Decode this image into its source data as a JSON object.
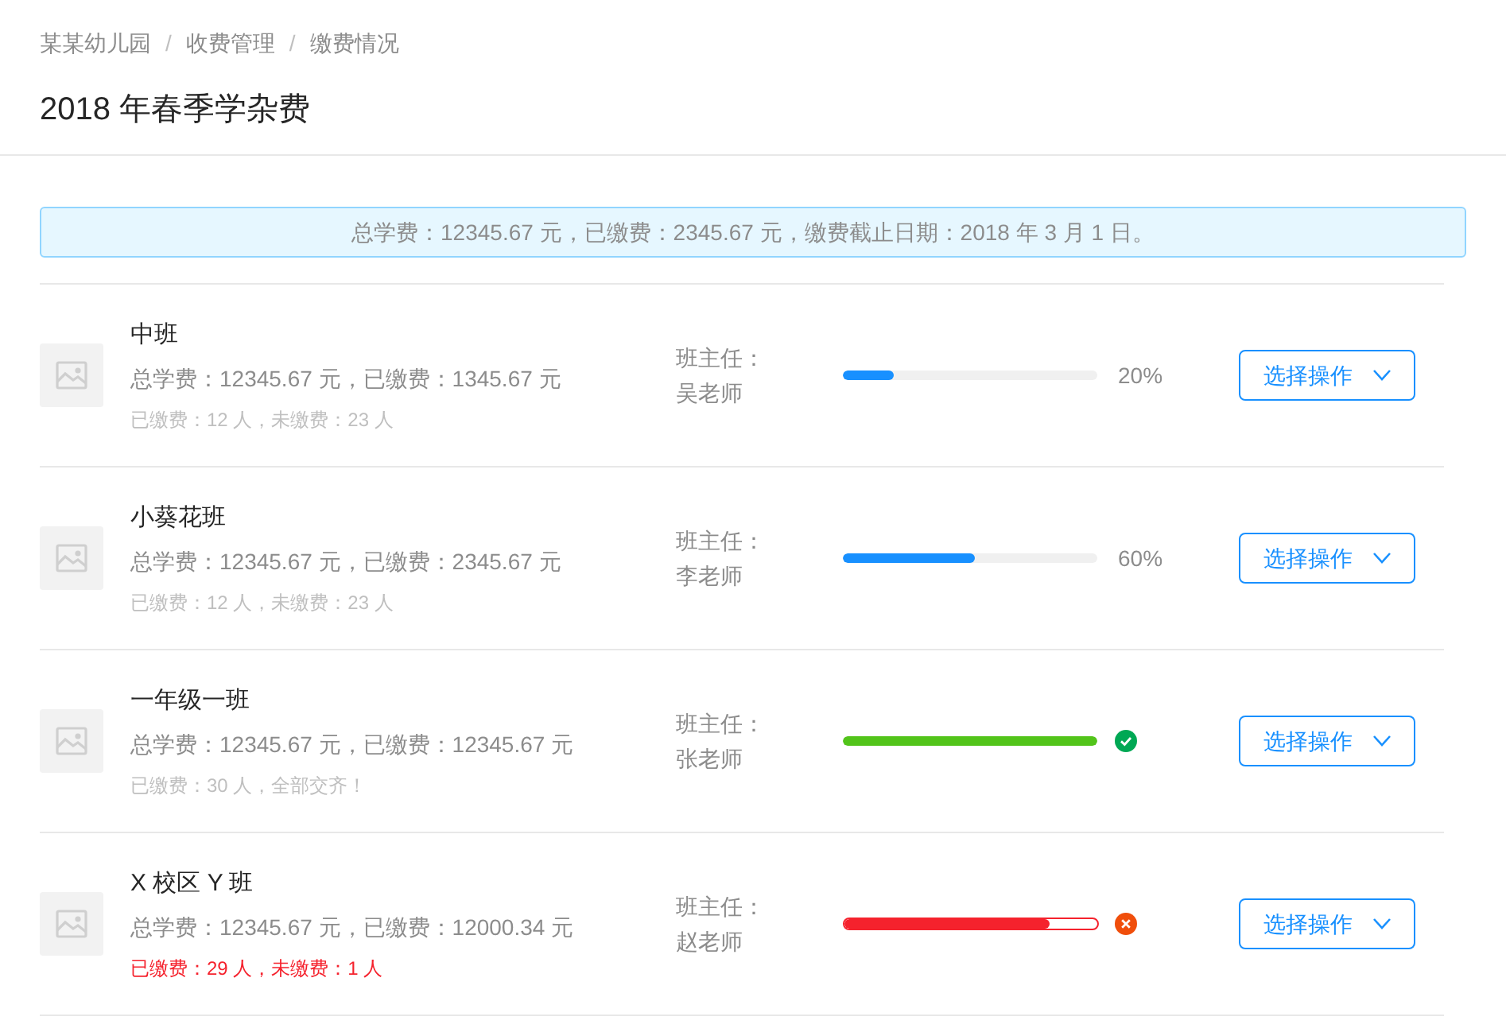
{
  "breadcrumb": [
    "某某幼儿园",
    "收费管理",
    "缴费情况"
  ],
  "breadcrumb_separator": "/",
  "title": "2018 年春季学杂费",
  "alert": "总学费：12345.67 元，已缴费：2345.67 元，缴费截止日期：2018 年 3 月 1 日。",
  "rows": [
    {
      "name": "中班",
      "fees": "总学费：12345.67 元，已缴费：1345.67 元",
      "counts": "已缴费：12 人，未缴费：23 人",
      "warning": false,
      "head_label": "班主任：",
      "teacher": "吴老师",
      "progress": {
        "kind": "normal",
        "level": 0.2,
        "reading": "20%"
      },
      "action": "选择操作"
    },
    {
      "name": "小葵花班",
      "fees": "总学费：12345.67 元，已缴费：2345.67 元",
      "counts": "已缴费：12 人，未缴费：23 人",
      "warning": false,
      "head_label": "班主任：",
      "teacher": "李老师",
      "progress": {
        "kind": "normal",
        "level": 0.52,
        "reading": "60%"
      },
      "action": "选择操作"
    },
    {
      "name": "一年级一班",
      "fees": "总学费：12345.67 元，已缴费：12345.67 元",
      "counts": "已缴费：30 人，全部交齐！",
      "warning": false,
      "head_label": "班主任：",
      "teacher": "张老师",
      "progress": {
        "kind": "success",
        "level": 1
      },
      "action": "选择操作"
    },
    {
      "name": "X 校区 Y 班",
      "fees": "总学费：12345.67 元，已缴费：12000.34 元",
      "counts": "已缴费：29 人，未缴费：1 人",
      "warning": true,
      "head_label": "班主任：",
      "teacher": "赵老师",
      "progress": {
        "kind": "exception",
        "level": 0.81
      },
      "action": "选择操作"
    }
  ]
}
